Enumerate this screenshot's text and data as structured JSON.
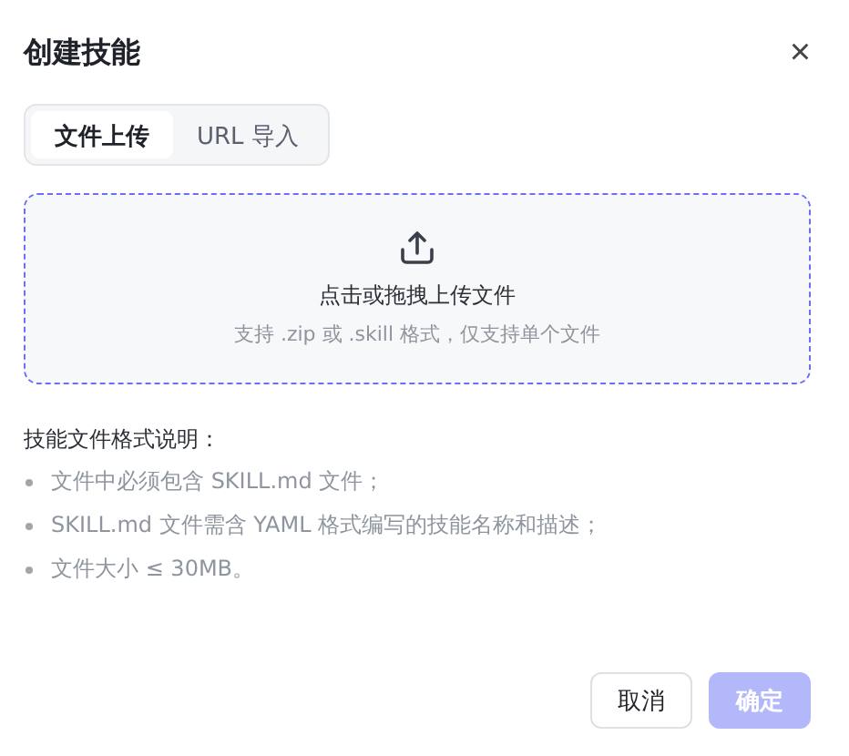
{
  "dialog": {
    "title": "创建技能",
    "close": "×"
  },
  "tabs": [
    {
      "label": "文件上传",
      "selected": true
    },
    {
      "label": "URL 导入",
      "selected": false
    }
  ],
  "upload": {
    "prompt": "点击或拖拽上传文件",
    "hint": "支持 .zip 或 .skill 格式，仅支持单个文件"
  },
  "format_notes": {
    "heading": "技能文件格式说明：",
    "items": [
      "文件中必须包含 SKILL.md 文件；",
      "SKILL.md 文件需含 YAML 格式编写的技能名称和描述；",
      "文件大小 ≤ 30MB。"
    ]
  },
  "buttons": [
    {
      "label": "取消",
      "kind": "secondary",
      "disabled": false
    },
    {
      "label": "确定",
      "kind": "primary",
      "disabled": true
    }
  ]
}
